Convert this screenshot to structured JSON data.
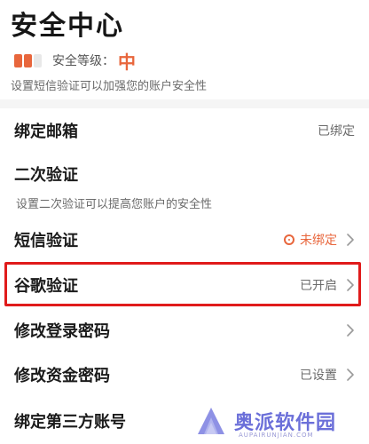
{
  "header": {
    "title": "安全中心"
  },
  "security": {
    "level_label": "安全等级：",
    "level_value": "中",
    "bar_colors": [
      "#e8663c",
      "#e8663c",
      "#e8e8e8"
    ],
    "tip": "设置短信验证可以加强您的账户安全性"
  },
  "rows": {
    "email": {
      "label": "绑定邮箱",
      "status": "已绑定"
    },
    "twofa": {
      "label": "二次验证",
      "subtitle": "设置二次验证可以提高您账户的安全性"
    },
    "sms": {
      "label": "短信验证",
      "status": "未绑定",
      "status_icon": "warning-circle-icon"
    },
    "google": {
      "label": "谷歌验证",
      "status": "已开启"
    },
    "login_password": {
      "label": "修改登录密码"
    },
    "fund_password": {
      "label": "修改资金密码",
      "status": "已设置"
    },
    "third_party": {
      "label": "绑定第三方账号"
    }
  },
  "watermark": {
    "text": "奥派软件园",
    "sub": "AUPAIRUNJIAN.COM"
  },
  "colors": {
    "accent": "#e8663c",
    "highlight": "#e01b1b",
    "watermark": "#6b6fd9"
  }
}
